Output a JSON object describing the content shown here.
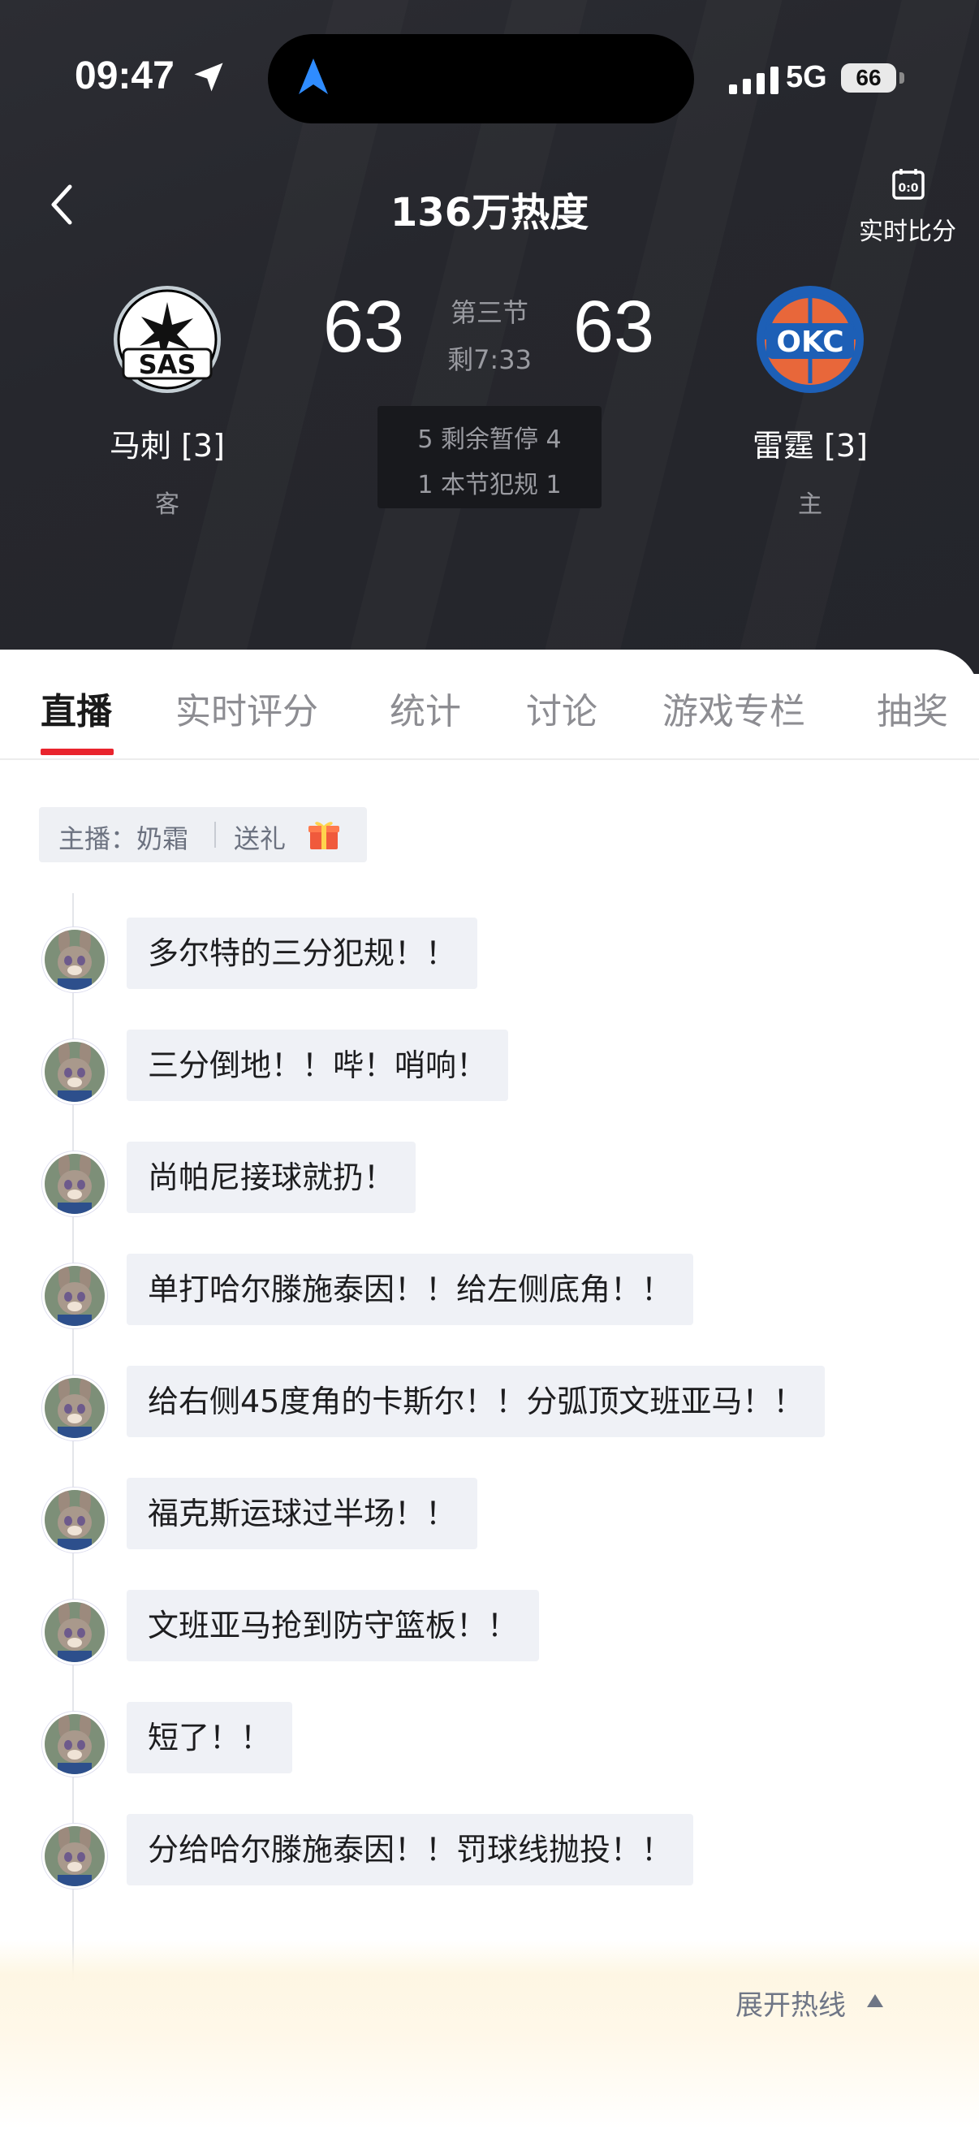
{
  "status_bar": {
    "time": "09:47",
    "network": "5G",
    "battery": "66"
  },
  "header": {
    "heat": "136万热度",
    "live_score_label": "实时比分"
  },
  "game": {
    "away": {
      "name": "马刺 [3]",
      "role": "客",
      "score": "63",
      "logo_text": "SAS"
    },
    "home": {
      "name": "雷霆 [3]",
      "role": "主",
      "score": "63",
      "logo_text": "OKC"
    },
    "period": "第三节",
    "clock": "剩7:33",
    "timeouts": "5 剩余暂停 4",
    "fouls": "1 本节犯规 1"
  },
  "tabs": [
    {
      "label": "直播",
      "active": true
    },
    {
      "label": "实时评分"
    },
    {
      "label": "统计"
    },
    {
      "label": "讨论"
    },
    {
      "label": "游戏专栏"
    },
    {
      "label": "抽奖"
    }
  ],
  "anchor": {
    "label": "主播：奶霜",
    "gift": "送礼"
  },
  "messages": [
    "多尔特的三分犯规！！",
    "三分倒地！！哔！哨响！",
    "尚帕尼接球就扔！",
    "单打哈尔滕施泰因！！给左侧底角！！",
    "给右侧45度角的卡斯尔！！分弧顶文班亚马！！",
    "福克斯运球过半场！！",
    "文班亚马抢到防守篮板！！",
    "短了！！",
    "分给哈尔滕施泰因！！罚球线抛投！！"
  ],
  "hotline": {
    "label": "展开热线"
  },
  "colors": {
    "accent": "#e9242d",
    "header_bg": "#26272d",
    "bubble_bg": "#eff1f6"
  }
}
